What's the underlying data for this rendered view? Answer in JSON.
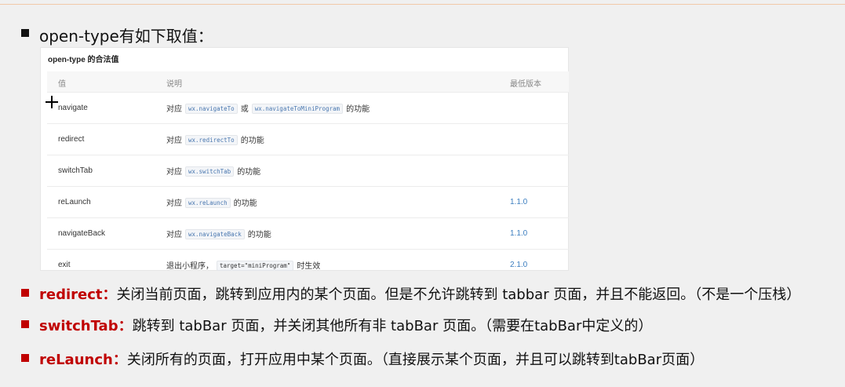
{
  "heading": "open-type有如下取值：",
  "table": {
    "title": "open-type 的合法值",
    "headers": [
      "值",
      "说明",
      "最低版本"
    ],
    "rows": [
      {
        "value": "navigate",
        "desc_prefix": "对应",
        "code1": "wx.navigateTo",
        "mid": "或",
        "code2": "wx.navigateToMiniProgram",
        "desc_suffix": "的功能",
        "version": ""
      },
      {
        "value": "redirect",
        "desc_prefix": "对应",
        "code1": "wx.redirectTo",
        "desc_suffix": "的功能",
        "version": ""
      },
      {
        "value": "switchTab",
        "desc_prefix": "对应",
        "code1": "wx.switchTab",
        "desc_suffix": "的功能",
        "version": ""
      },
      {
        "value": "reLaunch",
        "desc_prefix": "对应",
        "code1": "wx.reLaunch",
        "desc_suffix": "的功能",
        "version": "1.1.0"
      },
      {
        "value": "navigateBack",
        "desc_prefix": "对应",
        "code1": "wx.navigateBack",
        "desc_suffix": "的功能",
        "version": "1.1.0"
      },
      {
        "value": "exit",
        "desc_prefix": "退出小程序，",
        "code1": "target=\"miniProgram\"",
        "desc_suffix": "时生效",
        "version": "2.1.0"
      }
    ]
  },
  "notes": [
    {
      "keyword": "redirect：",
      "text": "关闭当前页面，跳转到应用内的某个页面。但是不允许跳转到 tabbar 页面，并且不能返回。（不是一个压栈）"
    },
    {
      "keyword": "switchTab：",
      "text": "跳转到 tabBar 页面，并关闭其他所有非 tabBar 页面。（需要在tabBar中定义的）"
    },
    {
      "keyword": "reLaunch：",
      "text": "关闭所有的页面，打开应用中某个页面。（直接展示某个页面，并且可以跳转到tabBar页面）"
    }
  ],
  "colors": {
    "accent": "#c00000",
    "link": "#3b7dbf"
  }
}
